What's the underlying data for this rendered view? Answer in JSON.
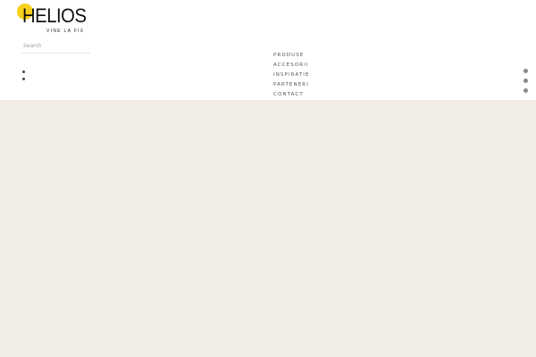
{
  "colors": {
    "logo_sun": "#f6d11b",
    "content_background": "#f1ede6"
  },
  "logo": {
    "name": "HELIOS",
    "tagline": "VINE LA FIX"
  },
  "search": {
    "placeholder": "Search"
  },
  "nav": {
    "items": [
      {
        "label": "PRODUSE"
      },
      {
        "label": "ACCESORII"
      },
      {
        "label": "INSPIRATIE"
      },
      {
        "label": "PARTENERI"
      },
      {
        "label": "CONTACT"
      }
    ]
  }
}
